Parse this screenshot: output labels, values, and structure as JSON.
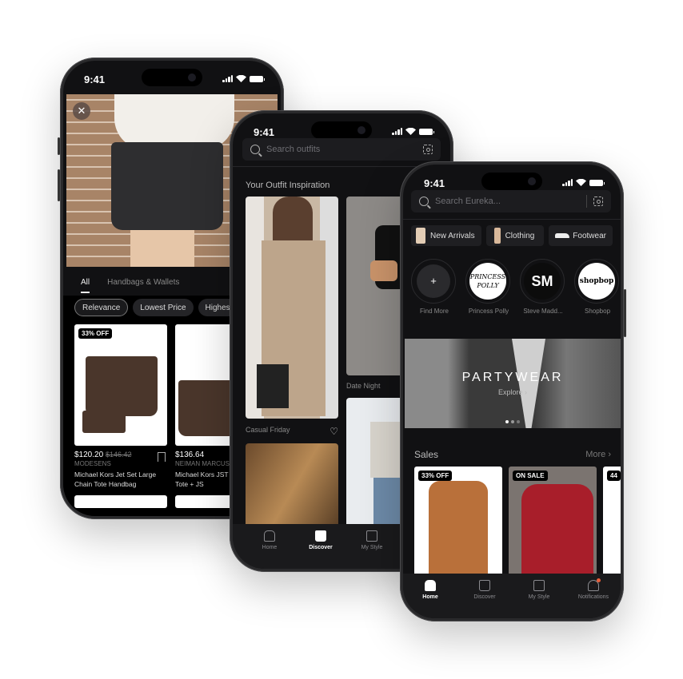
{
  "status_time": "9:41",
  "phone_left": {
    "tabs": [
      "All",
      "Handbags & Wallets"
    ],
    "sort_chips": [
      "Relevance",
      "Lowest Price",
      "Highest"
    ],
    "products": [
      {
        "badge": "33% OFF",
        "price": "$120.20",
        "original_price": "$146.42",
        "store": "MODESENS",
        "name": "Michael Kors Jet Set Large Chain Tote Handbag"
      },
      {
        "badge": "",
        "price": "$136.64",
        "original_price": "",
        "store": "NEIMAN MARCUS",
        "name": "Michael Kors JST L Shoulder Tote + JS"
      }
    ]
  },
  "phone_mid": {
    "search_placeholder": "Search outfits",
    "section_title": "Your Outfit Inspiration",
    "outfits": [
      "Casual Friday",
      "Date Night"
    ],
    "tabbar": [
      "Home",
      "Discover",
      "My Style"
    ],
    "active_tab": "Discover"
  },
  "phone_right": {
    "search_placeholder": "Search Eureka...",
    "categories": [
      "New Arrivals",
      "Clothing",
      "Footwear"
    ],
    "brands": [
      {
        "name": "Find More",
        "logo": "+"
      },
      {
        "name": "Princess Polly",
        "logo": "PRINCESS POLLY"
      },
      {
        "name": "Steve Madd...",
        "logo": "SM"
      },
      {
        "name": "Shopbop",
        "logo": "shopbop"
      }
    ],
    "banner": {
      "title": "PARTYWEAR",
      "cta": "Explore ›",
      "slide": 1,
      "slides": 3
    },
    "sales": {
      "title": "Sales",
      "more": "More ›",
      "badges": [
        "33% OFF",
        "ON SALE",
        "44"
      ]
    },
    "tabbar": [
      "Home",
      "Discover",
      "My Style",
      "Notifications"
    ],
    "active_tab": "Home",
    "notification_color": "#e8603c"
  }
}
